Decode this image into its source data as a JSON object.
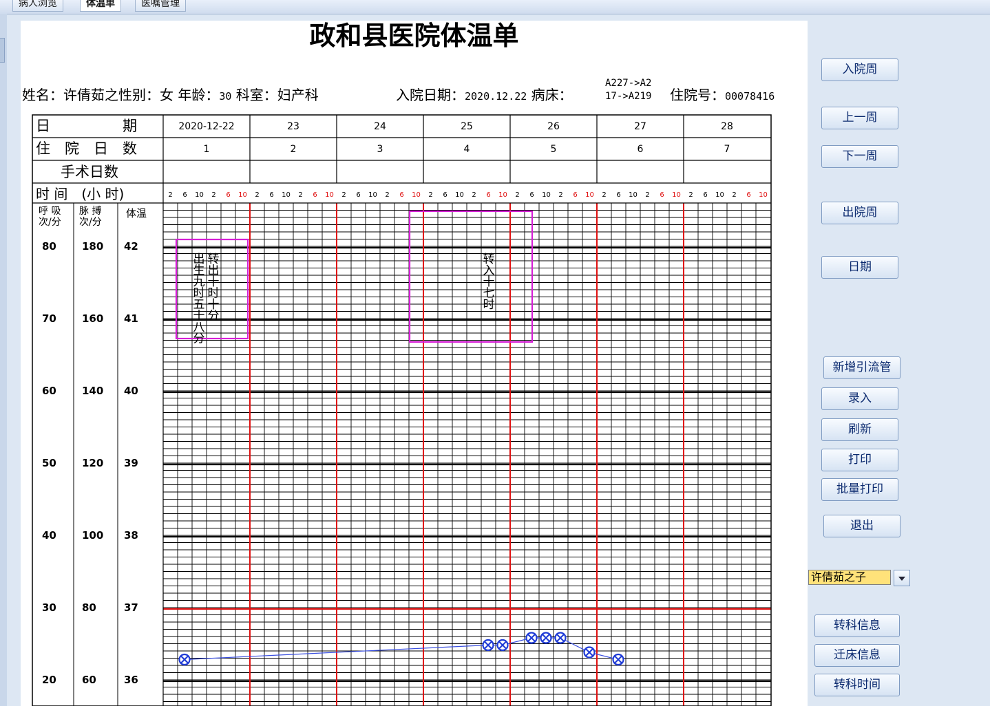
{
  "tabs": [
    "病人浏览",
    "体温单",
    "医嘱管理"
  ],
  "active_tab": 1,
  "sheet": {
    "title": "政和县医院体温单",
    "name_label": "姓名：",
    "name_value": "许倩茹之",
    "gender_label": "性别：",
    "gender_value": "女",
    "age_label": "年龄：",
    "age_value": "30",
    "dept_label": "科室：",
    "dept_value": "妇产科",
    "admit_label": "入院日期：",
    "admit_value": "2020.12.22",
    "bed_label": "病床：",
    "bed_value_line1": "A227->A2",
    "bed_value_line2": "17->A219",
    "hospno_label": "住院号：",
    "hospno_value": "00078416"
  },
  "table": {
    "row_date_label": "日　　　　　期",
    "row_days_label": "住　院　日　数",
    "row_surgery_label": "手术日数",
    "row_time_label": "时 间　(小 时)",
    "col_resp_label": "呼 吸\n次/分",
    "col_pulse_label": "脉 搏\n次/分",
    "col_temp_label": "体温",
    "dates": [
      "2020-12-22",
      "23",
      "24",
      "25",
      "26",
      "27",
      "28"
    ],
    "hospital_days": [
      "1",
      "2",
      "3",
      "4",
      "5",
      "6",
      "7"
    ],
    "hours": [
      "2",
      "6",
      "10",
      "2",
      "6",
      "10"
    ],
    "scale": [
      {
        "resp": "80",
        "pulse": "180",
        "temp": "42"
      },
      {
        "resp": "70",
        "pulse": "160",
        "temp": "41"
      },
      {
        "resp": "60",
        "pulse": "140",
        "temp": "40"
      },
      {
        "resp": "50",
        "pulse": "120",
        "temp": "39"
      },
      {
        "resp": "40",
        "pulse": "100",
        "temp": "38"
      },
      {
        "resp": "30",
        "pulse": "80",
        "temp": "37"
      },
      {
        "resp": "20",
        "pulse": "60",
        "temp": "36"
      }
    ],
    "events": [
      {
        "col1": "出生九时五十八分",
        "col2": "转出十时十分"
      },
      {
        "col1": "转入十七时"
      }
    ]
  },
  "chart_data": {
    "type": "line",
    "series": [
      {
        "marker": "circle-x",
        "color": "#1f3bd6",
        "points": [
          {
            "slot": 1,
            "temp": 36.3
          },
          {
            "slot": 22,
            "temp": 36.5
          },
          {
            "slot": 23,
            "temp": 36.5
          },
          {
            "slot": 25,
            "temp": 36.6
          },
          {
            "slot": 26,
            "temp": 36.6
          },
          {
            "slot": 27,
            "temp": 36.6
          },
          {
            "slot": 29,
            "temp": 36.4
          },
          {
            "slot": 31,
            "temp": 36.3
          }
        ]
      }
    ],
    "ylim": [
      35.7,
      42.8
    ],
    "reference_line": 37
  },
  "buttons": {
    "admit_week": "入院周",
    "prev_week": "上一周",
    "next_week": "下一周",
    "discharge_week": "出院周",
    "date": "日期",
    "add_drain": "新增引流管",
    "entry": "录入",
    "refresh": "刷新",
    "print": "打印",
    "batch_print": "批量打印",
    "exit": "退出",
    "transfer_dept_info": "转科信息",
    "transfer_bed_info": "迁床信息",
    "transfer_dept_time": "转科时间"
  },
  "patient_select": "许倩茹之子"
}
